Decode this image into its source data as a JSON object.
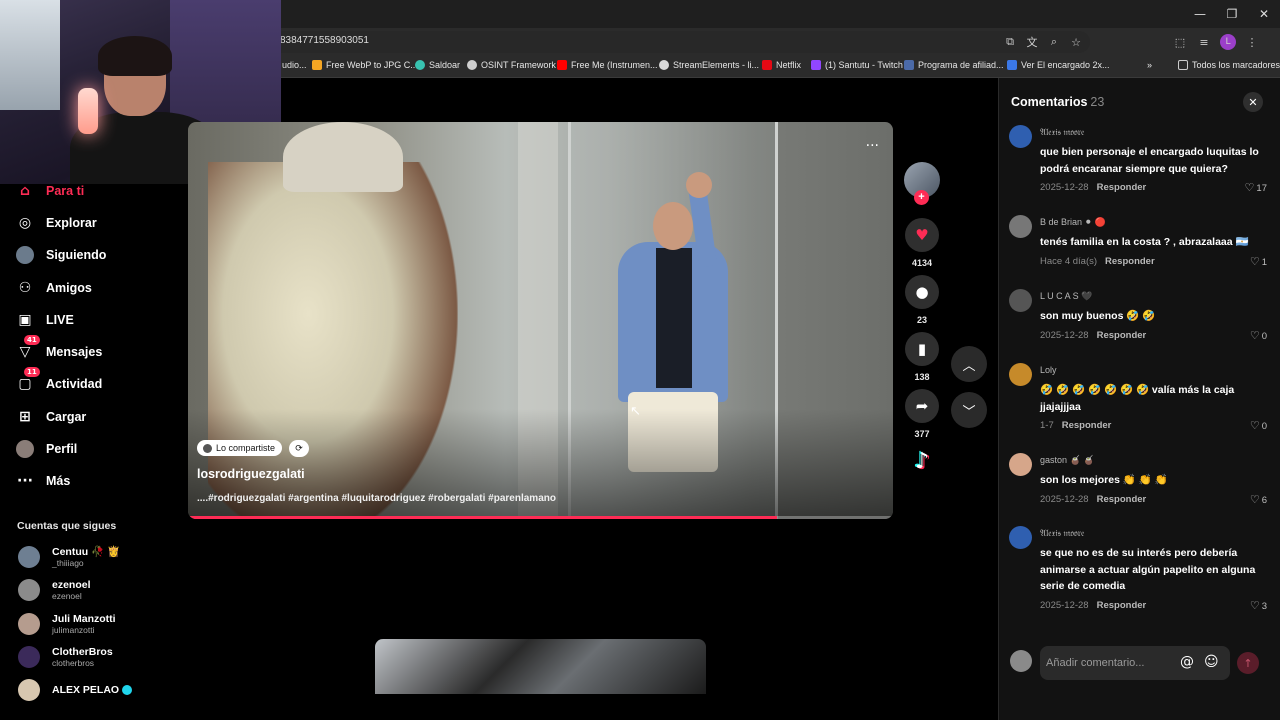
{
  "browser": {
    "url_fragment": "8384771558903051",
    "bookmarks": [
      {
        "label": "udio...",
        "color": "#444"
      },
      {
        "label": "Free WebP to JPG C...",
        "color": "#f5a623"
      },
      {
        "label": "Saldoar",
        "color": "#38c2b0"
      },
      {
        "label": "OSINT Framework",
        "color": "#cfcfcf"
      },
      {
        "label": "Free Me (Instrumen...",
        "color": "#ff0000"
      },
      {
        "label": "StreamElements - li...",
        "color": "#d9d9d9"
      },
      {
        "label": "Netflix",
        "color": "#e50914"
      },
      {
        "label": "(1) Santutu - Twitch",
        "color": "#9146ff"
      },
      {
        "label": "Programa de afiliad...",
        "color": "#4b6aa8"
      },
      {
        "label": "Ver El encargado 2x...",
        "color": "#3b78e7"
      }
    ],
    "bookmarks_more": "»",
    "all_bookmarks": "Todos los marcadores",
    "profile_letter": "L"
  },
  "sidebar": {
    "items": [
      {
        "label": "Para ti",
        "icon": "home-icon"
      },
      {
        "label": "Explorar",
        "icon": "compass-icon"
      },
      {
        "label": "Siguiendo",
        "icon": "following-icon"
      },
      {
        "label": "Amigos",
        "icon": "friends-icon"
      },
      {
        "label": "LIVE",
        "icon": "live-icon"
      },
      {
        "label": "Mensajes",
        "icon": "messages-icon",
        "badge": "41"
      },
      {
        "label": "Actividad",
        "icon": "activity-icon",
        "badge": "11"
      },
      {
        "label": "Cargar",
        "icon": "upload-icon"
      },
      {
        "label": "Perfil",
        "icon": "profile-icon"
      },
      {
        "label": "Más",
        "icon": "more-icon"
      }
    ],
    "following_title": "Cuentas que sigues",
    "following": [
      {
        "name": "Centuu 🥀 👸",
        "handle": "_thiiiago"
      },
      {
        "name": "ezenoel",
        "handle": "ezenoel"
      },
      {
        "name": "Juli Manzotti",
        "handle": "julimanzotti"
      },
      {
        "name": "ClotherBros",
        "handle": "clotherbros"
      },
      {
        "name": "ALEX PELAO",
        "handle": ""
      }
    ]
  },
  "video": {
    "shared_label": "Lo compartiste",
    "username": "losrodriguezgalati",
    "caption": "....#rodriguezgalati #argentina #luquitarodriguez #robergalati #parenlamano",
    "progress": 0.835,
    "more": "···"
  },
  "actions": {
    "likes": "4134",
    "comments": "23",
    "saves": "138",
    "shares": "377"
  },
  "comments_panel": {
    "title": "Comentarios",
    "count": "23",
    "input_placeholder": "Añadir comentario...",
    "reply_label": "Responder",
    "comments": [
      {
        "user": "𝔄𝔩𝔢𝔵𝔦𝔰 𝔪𝔬𝔬𝔯𝔢",
        "text": "que bien personaje el encargado luquitas lo podrá encaranar siempre que quiera?",
        "date": "2025-12-28",
        "likes": "17",
        "av": "#2f5fb0"
      },
      {
        "user": "B de Brian ⚫ 🔴",
        "text": "tenés familia en la costa ? , abrazalaaa 🇦🇷",
        "date": "Hace 4 día(s)",
        "likes": "1",
        "av": "#777"
      },
      {
        "user": "L U C A S 🖤",
        "text": "son muy buenos 🤣 🤣",
        "date": "2025-12-28",
        "likes": "0",
        "av": "#555"
      },
      {
        "user": "Loly",
        "text": "🤣 🤣 🤣 🤣 🤣 🤣 🤣 valía más la caja jjajajjjaa",
        "date": "1-7",
        "likes": "0",
        "av": "#c68a2a"
      },
      {
        "user": "gaston 🧉 🧉",
        "text": "son los mejores 👏 👏 👏",
        "date": "2025-12-28",
        "likes": "6",
        "av": "#d6a68a"
      },
      {
        "user": "𝔄𝔩𝔢𝔵𝔦𝔰 𝔪𝔬𝔬𝔯𝔢",
        "text": "se que no es de su interés pero debería animarse a actuar algún papelito en alguna serie de comedia",
        "date": "2025-12-28",
        "likes": "3",
        "av": "#2f5fb0"
      }
    ]
  }
}
